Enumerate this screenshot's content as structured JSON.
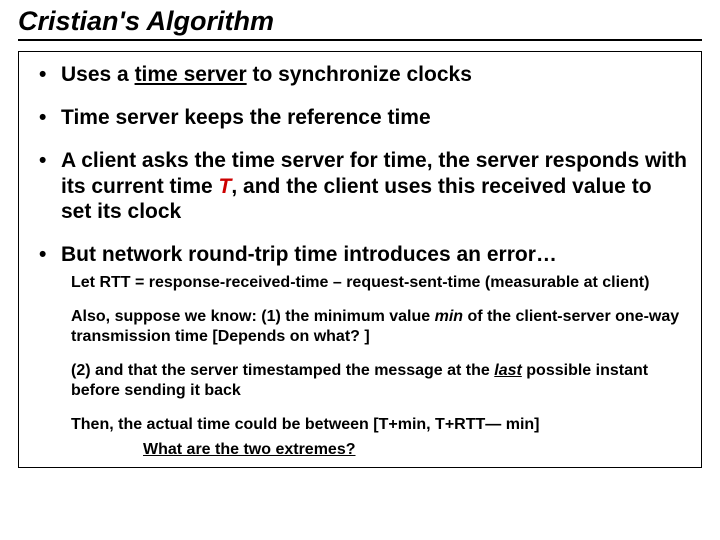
{
  "title": "Cristian's Algorithm",
  "bullets": {
    "b1_pre": "Uses a ",
    "b1_u": "time server",
    "b1_post": " to synchronize clocks",
    "b2": "Time server keeps the reference time",
    "b3_pre": "A client asks the time server for time, the server responds with its current time ",
    "b3_T": "T",
    "b3_post": ", and the client uses this received value to set its clock",
    "b4": "But network round-trip time introduces an error…"
  },
  "subs": {
    "s1": "Let RTT = response-received-time – request-sent-time (measurable at client)",
    "s2_pre": "Also, suppose we know: (1) the minimum value ",
    "s2_min": "min",
    "s2_post": " of the client-server one-way transmission time [Depends on what? ]",
    "s3_pre": "(2) and that the server timestamped the message at the ",
    "s3_last": "last",
    "s3_post": " possible instant before sending it back",
    "s4": "Then, the actual time could be between [T+min, T+RTT— min]"
  },
  "question": "What are the two extremes?"
}
